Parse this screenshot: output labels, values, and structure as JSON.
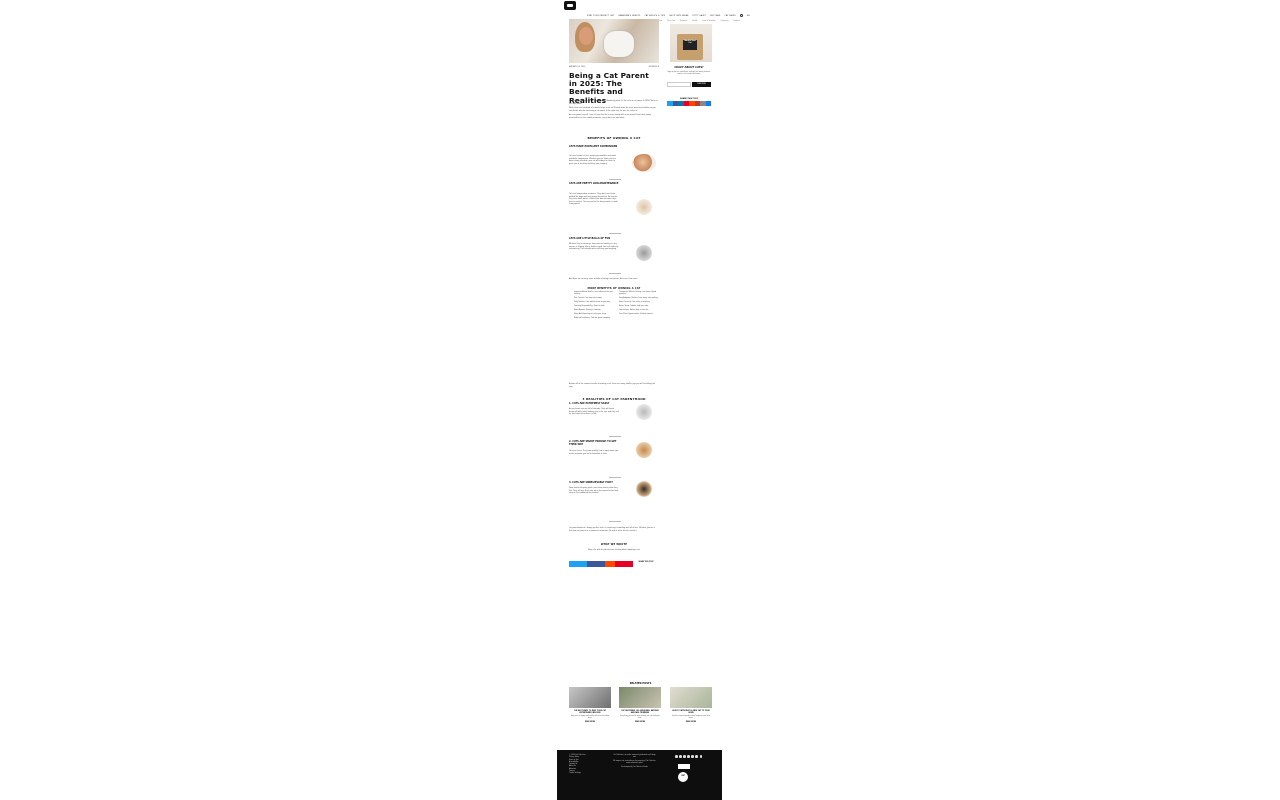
{
  "nav": {
    "items": [
      "FIND YOUR PERFECT CAT",
      "GRANDMA'S GREETS",
      "CAT ADVICE & TIPS",
      "SHOP CATS WEAR",
      "KITTY SAINT",
      "CAT CARE",
      "CAT NEWS",
      "ABOUT",
      "EN"
    ],
    "subitems": [
      "Cat Trivia & Fun Facts",
      "Cat Collective",
      "Cat Kits & Lifestyle",
      "Kitty Care",
      "Behavior",
      "Health",
      "Food & Nutrition",
      "Grooming",
      "Products"
    ]
  },
  "article": {
    "date": "JANUARY 14, 2025",
    "category": "CAT ADVICE",
    "title": "Being a Cat Parent in 2025: The Benefits and Realities",
    "intro": [
      "Curious about the benefits of owning a cat? Wondering what it's like to be a cat parent in 2025? You're in the right place!",
      "While there are hundreds of reasons to get a cat, we'll break down the main perks and realities so you can decide whether becoming a cat parent is the right step for you. Let's dive in!",
      "As a cat parent myself, I can tell you that life is never boring with a cat around. From their quirky personalities to their cuddly moments, every day is an adventure."
    ],
    "benefits_heading": "BENEFITS OF OWNING A CAT",
    "benefits": [
      {
        "title": "CATS MAKE EXCELLENT COMPANIONS",
        "text": "Cats are known for their unique personalities and make wonderful companions. Whether you are home alone or have a busy schedule, your cat will always be there to greet you at the door and keep you company."
      },
      {
        "title": "CATS ARE PRETTY LOW-MAINTENANCE",
        "text": "Cats are independent creatures. They don't need to be walked like dogs and they groom themselves. As long as they have food, water, a clean litter box and some toys, they're content. Cats are perfect for busy people or small living spaces."
      },
      {
        "title": "CATS ARE LITTLE BALLS OF FUN",
        "text": "Whether they're chasing a laser pointer, batting at a toy mouse, or leaping after a feather wand, cats are endlessly entertaining. Their playful antics will keep you laughing."
      }
    ],
    "benefits_outro": "And there are so many more benefits of being a cat parent. Here are a few more:",
    "more_heading": "MORE BENEFITS OF OWNING A CAT",
    "more_left": [
      "Improved Mental Health: Cats reduce stress and anxiety.",
      "Pest Control: Cats keep mice away.",
      "Daily Routine: Cats add structure to your day.",
      "Teaching Responsibility: Great for kids.",
      "Mood Booster: Purring is calming.",
      "Sleep Aid: A purring cat helps you sleep.",
      "Reduced Loneliness: Cats are great company."
    ],
    "more_right": [
      "Therapeutic Effects: Petting a cat lowers blood pressure.",
      "Easy Adoption: Shelters have many cats waiting.",
      "Home Security: Cats notice everything.",
      "Better Sleep: Cuddles help you relax.",
      "Convenience Factor: Easy to care for.",
      "Cute Photo Opportunities: Endless content."
    ],
    "more_outro": "Besides all of the serious benefits of owning a cat, there are many smaller joys you will find along the way.",
    "realities_heading": "3 REALITIES OF CAT PARENTHOOD",
    "realities": [
      {
        "title": "1. CATS ARE EXTREMELY SASSY",
        "text": "As you know, cats are full of attitude. They will knock things off tables while looking you in the eye, and they will let you know when dinner is late."
      },
      {
        "title": "2. CATS ARE SMART ENOUGH TO GET THEIR WAY",
        "text": "Cats are clever. They learn quickly how to open doors, get treats and wake you up for breakfast at 5am."
      },
      {
        "title": "3. CATS ARE UNBELIEVABLY PICKY",
        "text": "From food to sleeping spots, cats know exactly what they like. They will turn their nose up at the expensive bed and sleep in the cardboard box instead."
      }
    ],
    "outro": "Cat parenthood isn't always perfect, but it is surprising, rewarding and full of love. Whether you are a first-time cat parent or a seasoned cat person, life with a feline friend is worth it.",
    "what_heading": "WHAT WE WROTE",
    "what_text": "Share this with friends who are thinking about adopting a cat."
  },
  "sidebar": {
    "tote_label": "World's Best Cat",
    "title": "CRAZY ABOUT CATS?",
    "text": "Sign up for our newsletter and get the latest pictures, stories, cat trends, and more.",
    "input_placeholder": "Enter your email",
    "button": "SUBSCRIBE",
    "share_heading": "SHARE THIS POST"
  },
  "share_heading": "SHARE THIS POST",
  "related": {
    "heading": "RELATED POSTS",
    "posts": [
      {
        "title": "THE BEST WAYS TO KEEP YOUR CAT ENTERTAINED INDOORS",
        "desc": "Keep your cat happy and healthy with these fun indoor ideas.",
        "rm": "READ MORE"
      },
      {
        "title": "CAT GROOMING 101: BRUSHING, BATHING AND NAIL TRIMMING",
        "desc": "Everything you need to know to keep your cat looking its best.",
        "rm": "READ MORE"
      },
      {
        "title": "HOW TO INTRODUCE A NEW CAT TO YOUR HOME",
        "desc": "Tips for a smooth transition when bringing a new feline home.",
        "rm": "READ MORE"
      }
    ]
  },
  "footer": {
    "copyright": "© 2025 Cat Collective",
    "links": [
      "Privacy Policy",
      "Terms of Use",
      "Accessibility",
      "Contact Us",
      "About Us",
      "Advertise",
      "Careers",
      "Cookie Settings"
    ],
    "center": [
      "Cat Collective is an online community dedicated to all things cats.",
      "All images, text, and video are the property of Cat Collective unless otherwise noted.",
      "Site designed by Cat Collective Studio."
    ],
    "badge": "SUBSCRIBE",
    "cert": "CERT"
  },
  "colors": {
    "footer_bg": "#0e0e0e",
    "share": [
      "#1da1f2",
      "#3b5998",
      "#0e76a8",
      "#e60023",
      "#ff4500",
      "#25d366",
      "#ff6600",
      "#1877f2"
    ]
  }
}
